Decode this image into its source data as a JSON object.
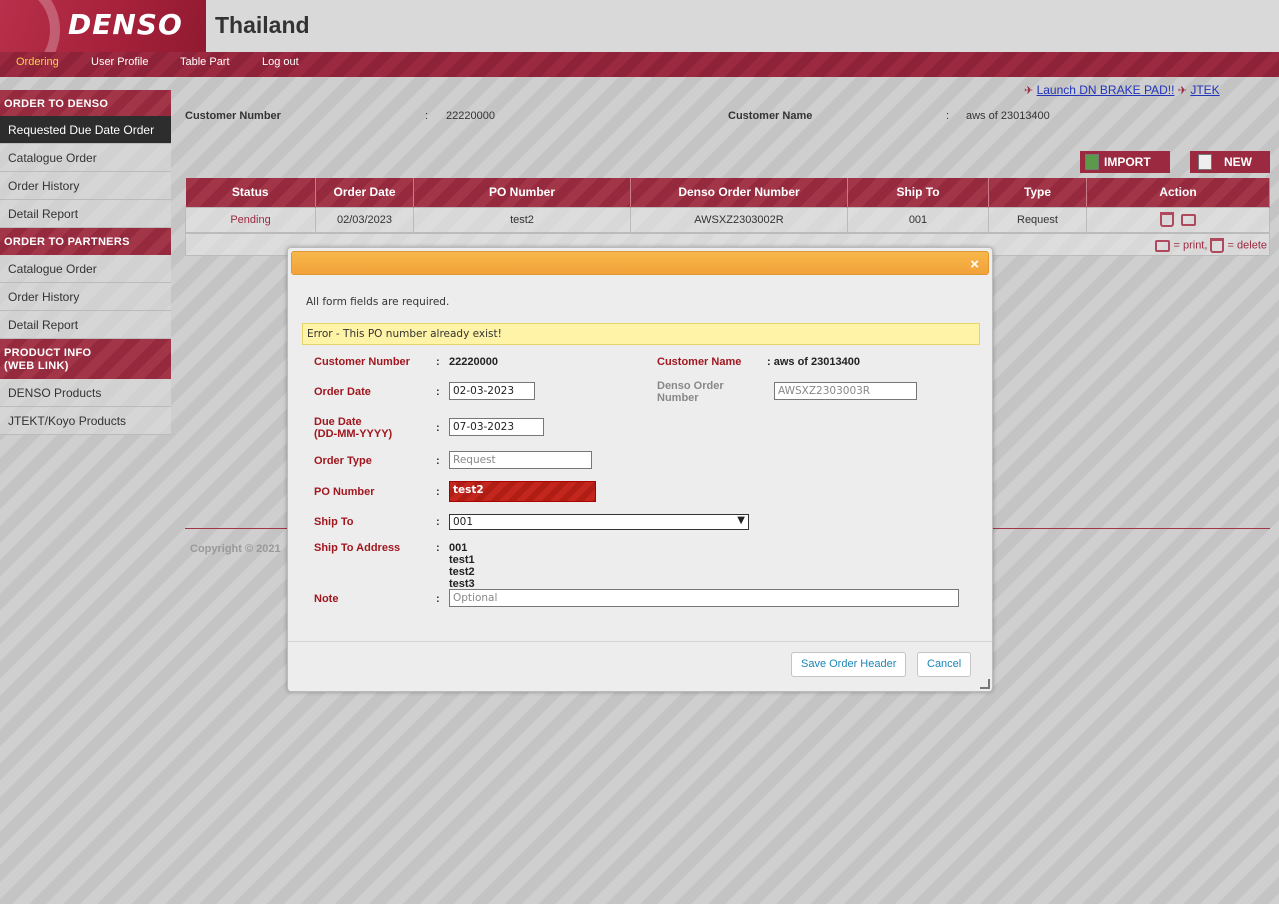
{
  "header": {
    "logo": "DENSO",
    "country": "Thailand"
  },
  "nav": {
    "items": [
      "Ordering",
      "User Profile",
      "Table Part",
      "Log out"
    ],
    "active": "Ordering"
  },
  "sidebar": {
    "sections": [
      {
        "title": "ORDER TO DENSO",
        "items": [
          "Requested Due Date Order",
          "Catalogue Order",
          "Order History",
          "Detail Report"
        ]
      },
      {
        "title": "ORDER TO PARTNERS",
        "items": [
          "Catalogue Order",
          "Order History",
          "Detail Report"
        ]
      },
      {
        "title_line1": "PRODUCT INFO",
        "title_line2": "(WEB LINK)",
        "items": [
          "DENSO Products",
          "JTEKT/Koyo Products"
        ]
      }
    ],
    "active": "Requested Due Date Order"
  },
  "main": {
    "links": {
      "brake_pad": "Launch DN BRAKE PAD!!",
      "jtek": "JTEK"
    },
    "customer_number_label": "Customer Number",
    "customer_number": "22220000",
    "customer_name_label": "Customer Name",
    "customer_name": "aws of 23013400",
    "colon": ":",
    "import_label": "IMPORT",
    "new_label": "NEW",
    "table": {
      "headers": [
        "Status",
        "Order Date",
        "PO Number",
        "Denso Order Number",
        "Ship To",
        "Type",
        "Action"
      ],
      "rows": [
        [
          "Pending",
          "02/03/2023",
          "test2",
          "AWSXZ2303002R",
          "001",
          "Request"
        ]
      ]
    },
    "legend": {
      "print": "= print,",
      "delete": "= delete"
    },
    "copyright": "Copyright © 2021"
  },
  "dialog": {
    "close": "×",
    "required_note": "All form fields are required.",
    "error": "Error - This PO number already exist!",
    "fields": {
      "customer_number_label": "Customer Number",
      "customer_number": "22220000",
      "customer_name_label": "Customer Name",
      "customer_name": ": aws of 23013400",
      "order_date_label": "Order Date",
      "order_date": "02-03-2023",
      "denso_order_label_1": "Denso Order",
      "denso_order_label_2": "Number",
      "denso_order_placeholder": "AWSXZ2303003R",
      "due_date_label_1": "Due Date",
      "due_date_label_2": "(DD-MM-YYYY)",
      "due_date": "07-03-2023",
      "order_type_label": "Order Type",
      "order_type_placeholder": "Request",
      "po_number_label": "PO Number",
      "po_number": "test2",
      "ship_to_label": "Ship To",
      "ship_to": "001",
      "ship_to_address_label": "Ship To Address",
      "ship_to_address": [
        "001",
        "test1",
        "test2",
        "test3"
      ],
      "note_label": "Note",
      "note_placeholder": "Optional"
    },
    "buttons": {
      "save": "Save Order Header",
      "cancel": "Cancel"
    }
  },
  "colors": {
    "brand": "#9b2a40",
    "dialog_title": "#f2a23a",
    "error_bg": "#fff3a8",
    "label_red": "#a0171f"
  }
}
